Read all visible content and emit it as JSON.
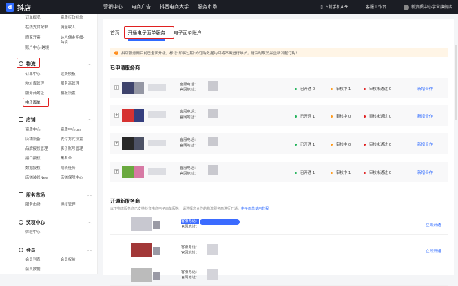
{
  "topbar": {
    "logo_text": "抖店",
    "nav": [
      "营销中心",
      "电商广告",
      "抖音电商大学",
      "服务市场"
    ],
    "download": "下载手机APP",
    "workbench": "客服工作台",
    "shop": "新资质中心宇宙旗舰店"
  },
  "sidebar": {
    "top_rows": [
      [
        "订单概况",
        "资质行政补单"
      ],
      [
        "在线支付配单",
        "佣金收入"
      ],
      [
        "商家开票",
        "达人佣金明细-"
      ],
      [
        "账户中心-跨境",
        "跨境"
      ]
    ],
    "logistics": {
      "title": "物流",
      "rows": [
        [
          "订单中心",
          "运费模板"
        ],
        [
          "地址库管理",
          "服务商管理"
        ],
        [
          "服务商地址",
          "模板设置"
        ]
      ],
      "active": "电子面单"
    },
    "store": {
      "title": "店铺",
      "rows": [
        [
          "资质中心",
          "资质中心grs"
        ],
        [
          "店铺设备",
          "支付方式设置"
        ],
        [
          "品牌授权管理",
          "影子账号管理"
        ],
        [
          "接口授权",
          "黑名单"
        ],
        [
          "数据授权",
          "成长任务"
        ],
        [
          "店铺装修New",
          "店铺保障中心"
        ]
      ]
    },
    "market": {
      "title": "服务市场",
      "rows": [
        [
          "服务市场",
          "授权管理"
        ]
      ]
    },
    "growth": {
      "title": "奖项中心",
      "rows": [
        [
          "体验中心",
          ""
        ]
      ]
    },
    "member": {
      "title": "会员",
      "rows": [
        [
          "会员列表",
          "会员权益"
        ],
        [
          "会员数据",
          ""
        ]
      ]
    }
  },
  "tabs": {
    "home": "首页",
    "active": "开通电子面单服务",
    "account": "电子面单账户"
  },
  "notice": "抖店服务商目前已全面升级，标记\"即将过期\"的订购数据均回将不再进行维护，请及时取消并重新发起订购！",
  "applied": {
    "title": "已申请服务商",
    "labels": {
      "phone": "客服电话：",
      "site": "官网地址："
    },
    "rows": [
      {
        "opened": "已开通 0",
        "auditing": "审核中 1",
        "failed": "审核未通过 0",
        "action": "新增合作",
        "colors": [
          "#2a2f5c",
          "#8a8c9a"
        ]
      },
      {
        "opened": "已开通 1",
        "auditing": "审核中 0",
        "failed": "审核未通过 0",
        "action": "新增合作",
        "colors": [
          "#d21c1c",
          "#1f2a70"
        ]
      },
      {
        "opened": "已开通 1",
        "auditing": "审核中 0",
        "failed": "审核未通过 0",
        "action": "新增合作",
        "colors": [
          "#111111",
          "#3a3f55"
        ]
      },
      {
        "opened": "已开通 1",
        "auditing": "审核中 1",
        "failed": "审核未通过 0",
        "action": "新增合作",
        "colors": [
          "#5aa02a",
          "#d36b9a"
        ]
      }
    ]
  },
  "new_services": {
    "title": "开通新服务商",
    "desc": "以下物流服务商已支持抖音电商电子面单服务，请选择您合作的物流服务商进行开通。",
    "link": "电子面单使用教程",
    "labels": {
      "phone": "客服电话：",
      "site": "官网地址："
    },
    "rows": [
      {
        "action": "立即开通",
        "highlight": true,
        "color": "#c8c8d0"
      },
      {
        "action": "立即开通",
        "highlight": false,
        "color": "#a23838"
      },
      {
        "action": "",
        "highlight": false,
        "color": "#bbbbbb"
      }
    ]
  }
}
